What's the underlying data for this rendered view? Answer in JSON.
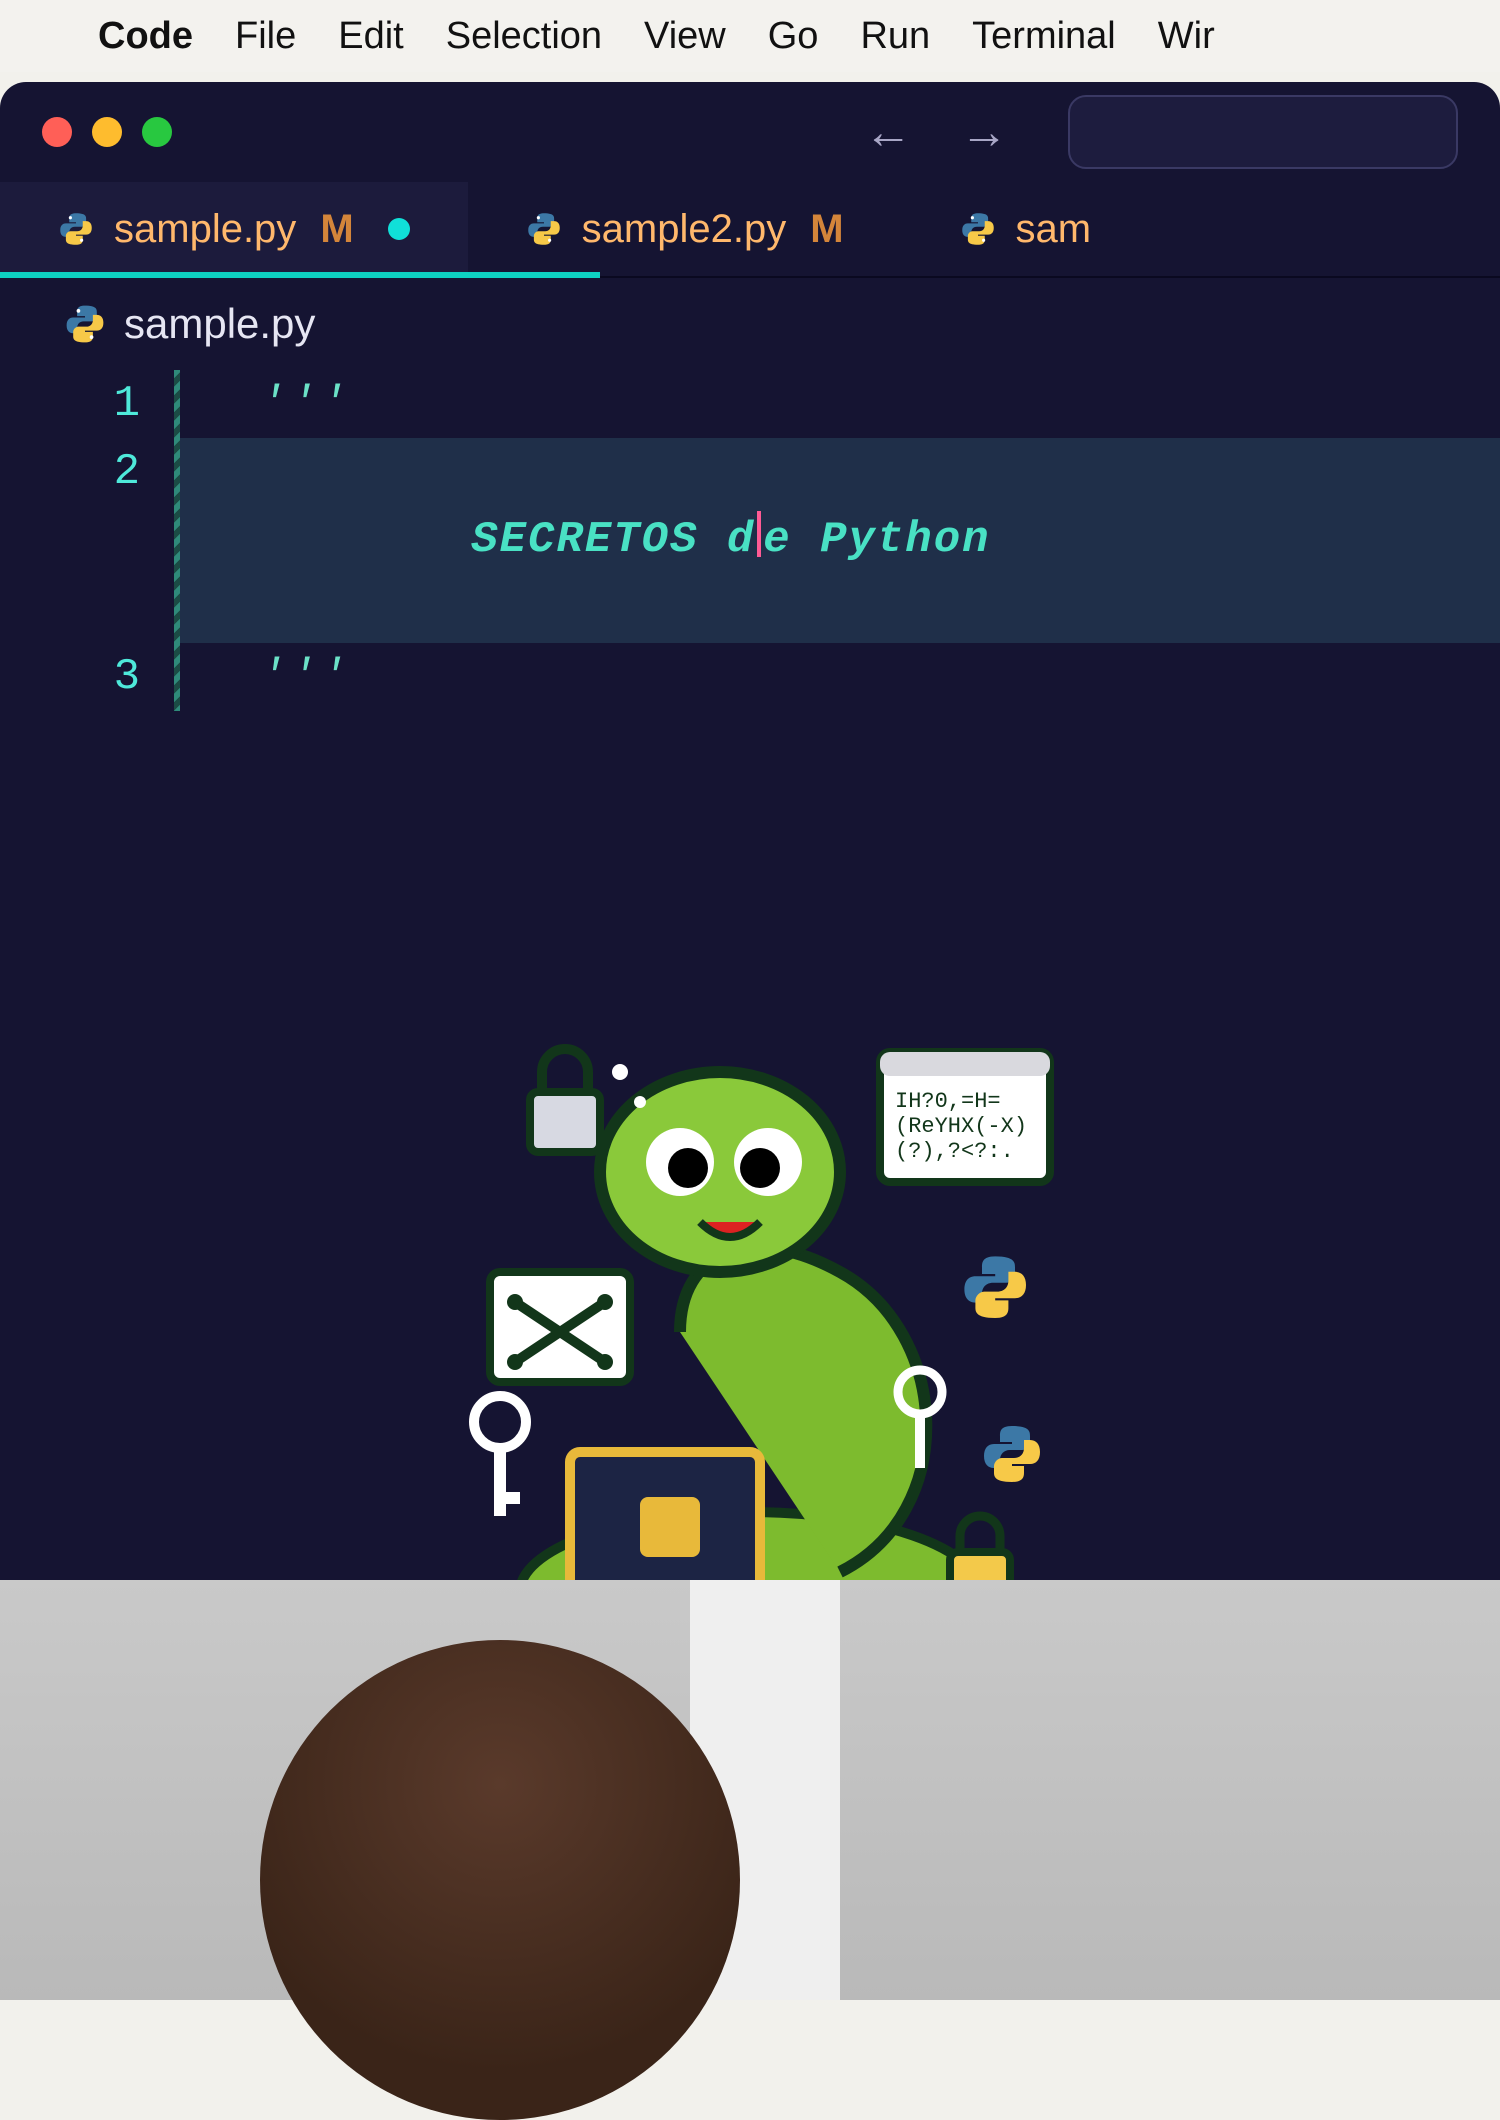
{
  "menubar": {
    "app": "Code",
    "items": [
      "File",
      "Edit",
      "Selection",
      "View",
      "Go",
      "Run",
      "Terminal",
      "Wir"
    ]
  },
  "tabs": [
    {
      "label": "sample.py",
      "modified": "M",
      "dirty": true,
      "active": true
    },
    {
      "label": "sample2.py",
      "modified": "M",
      "dirty": false,
      "active": false
    },
    {
      "label": "sam",
      "modified": "",
      "dirty": false,
      "active": false
    }
  ],
  "breadcrumb": {
    "file": "sample.py"
  },
  "code": {
    "lines": [
      {
        "n": "1",
        "kind": "docq",
        "text": "'''"
      },
      {
        "n": "2",
        "kind": "doc",
        "text_before": "SECRETOS d",
        "text_after": "e Python"
      },
      {
        "n": "3",
        "kind": "docq",
        "text": "'''"
      }
    ]
  }
}
